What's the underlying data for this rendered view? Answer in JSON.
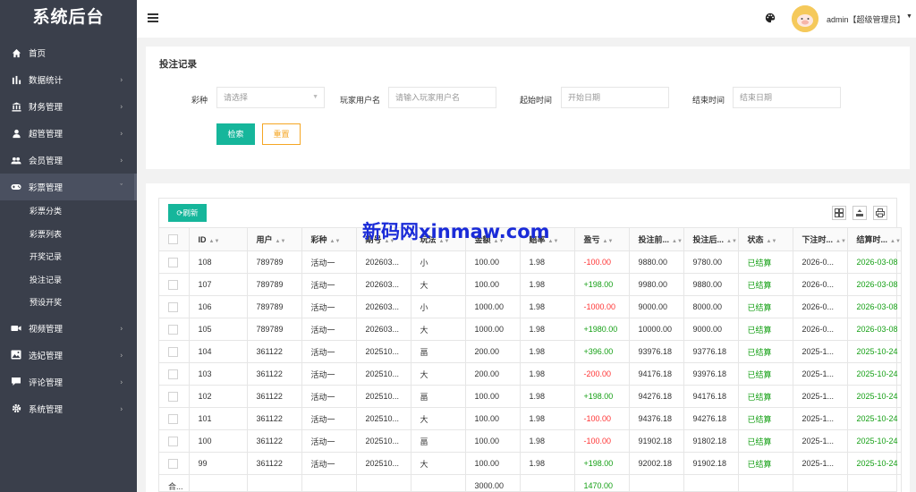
{
  "app": {
    "title": "系统后台"
  },
  "sidebar": {
    "items": [
      {
        "label": "首页",
        "icon": "home-icon",
        "arrow": false
      },
      {
        "label": "数据统计",
        "icon": "bar-chart-icon",
        "arrow": true
      },
      {
        "label": "财务管理",
        "icon": "bank-icon",
        "arrow": true
      },
      {
        "label": "超管管理",
        "icon": "user-icon",
        "arrow": true
      },
      {
        "label": "会员管理",
        "icon": "users-icon",
        "arrow": true
      },
      {
        "label": "彩票管理",
        "icon": "gamepad-icon",
        "arrow": true,
        "active": true
      },
      {
        "label": "视频管理",
        "icon": "video-icon",
        "arrow": true
      },
      {
        "label": "选妃管理",
        "icon": "image-icon",
        "arrow": true
      },
      {
        "label": "评论管理",
        "icon": "comment-icon",
        "arrow": true
      },
      {
        "label": "系统管理",
        "icon": "gear-icon",
        "arrow": true
      }
    ],
    "submenu": [
      "彩票分类",
      "彩票列表",
      "开奖记录",
      "投注记录",
      "预设开奖"
    ]
  },
  "header": {
    "user": "admin【超级管理员】"
  },
  "search": {
    "title": "投注记录",
    "lottery_label": "彩种",
    "lottery_placeholder": "请选择",
    "player_label": "玩家用户名",
    "player_placeholder": "请输入玩家用户名",
    "start_label": "起始时间",
    "start_placeholder": "开始日期",
    "end_label": "结束时间",
    "end_placeholder": "结束日期",
    "search_btn": "检索",
    "reset_btn": "重置"
  },
  "toolbar": {
    "refresh_label": "刷新"
  },
  "watermark": "新码网xinmaw.com",
  "table": {
    "headers": [
      "ID",
      "用户",
      "彩种",
      "期号",
      "玩法",
      "金额",
      "赔率",
      "盈亏",
      "投注前...",
      "投注后...",
      "状态",
      "下注时...",
      "结算时..."
    ],
    "rows": [
      [
        "108",
        "789789",
        "活动一",
        "202603...",
        "小",
        "100.00",
        "1.98",
        "-100.00",
        "9880.00",
        "9780.00",
        "已结算",
        "2026-0...",
        "2026-03-08"
      ],
      [
        "107",
        "789789",
        "活动一",
        "202603...",
        "大",
        "100.00",
        "1.98",
        "+198.00",
        "9980.00",
        "9880.00",
        "已结算",
        "2026-0...",
        "2026-03-08"
      ],
      [
        "106",
        "789789",
        "活动一",
        "202603...",
        "小",
        "1000.00",
        "1.98",
        "-1000.00",
        "9000.00",
        "8000.00",
        "已结算",
        "2026-0...",
        "2026-03-08"
      ],
      [
        "105",
        "789789",
        "活动一",
        "202603...",
        "大",
        "1000.00",
        "1.98",
        "+1980.00",
        "10000.00",
        "9000.00",
        "已结算",
        "2026-0...",
        "2026-03-08"
      ],
      [
        "104",
        "361122",
        "活动一",
        "202510...",
        "畐",
        "200.00",
        "1.98",
        "+396.00",
        "93976.18",
        "93776.18",
        "已结算",
        "2025-1...",
        "2025-10-24"
      ],
      [
        "103",
        "361122",
        "活动一",
        "202510...",
        "大",
        "200.00",
        "1.98",
        "-200.00",
        "94176.18",
        "93976.18",
        "已结算",
        "2025-1...",
        "2025-10-24"
      ],
      [
        "102",
        "361122",
        "活动一",
        "202510...",
        "畐",
        "100.00",
        "1.98",
        "+198.00",
        "94276.18",
        "94176.18",
        "已结算",
        "2025-1...",
        "2025-10-24"
      ],
      [
        "101",
        "361122",
        "活动一",
        "202510...",
        "大",
        "100.00",
        "1.98",
        "-100.00",
        "94376.18",
        "94276.18",
        "已结算",
        "2025-1...",
        "2025-10-24"
      ],
      [
        "100",
        "361122",
        "活动一",
        "202510...",
        "畐",
        "100.00",
        "1.98",
        "-100.00",
        "91902.18",
        "91802.18",
        "已结算",
        "2025-1...",
        "2025-10-24"
      ],
      [
        "99",
        "361122",
        "活动一",
        "202510...",
        "大",
        "100.00",
        "1.98",
        "+198.00",
        "92002.18",
        "91902.18",
        "已结算",
        "2025-1...",
        "2025-10-24"
      ]
    ],
    "total_label": "合...",
    "total_amount": "3000.00",
    "total_profit": "1470.00"
  },
  "colors": {
    "accent": "#16b69b",
    "sidebar": "#3a3f4b",
    "loss": "#ff3333",
    "gain": "#16a016",
    "reset": "#f5a623"
  }
}
